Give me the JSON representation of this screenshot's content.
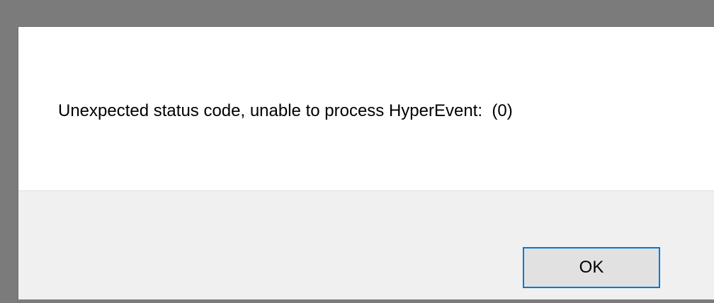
{
  "dialog": {
    "message": "Unexpected status code, unable to process HyperEvent:  (0)",
    "ok_label": "OK"
  },
  "colors": {
    "backdrop": "#7b7b7b",
    "dialog_background": "#ffffff",
    "button_area": "#f0f0f0",
    "button_face": "#e1e1e1",
    "focus_border": "#0078d7"
  }
}
